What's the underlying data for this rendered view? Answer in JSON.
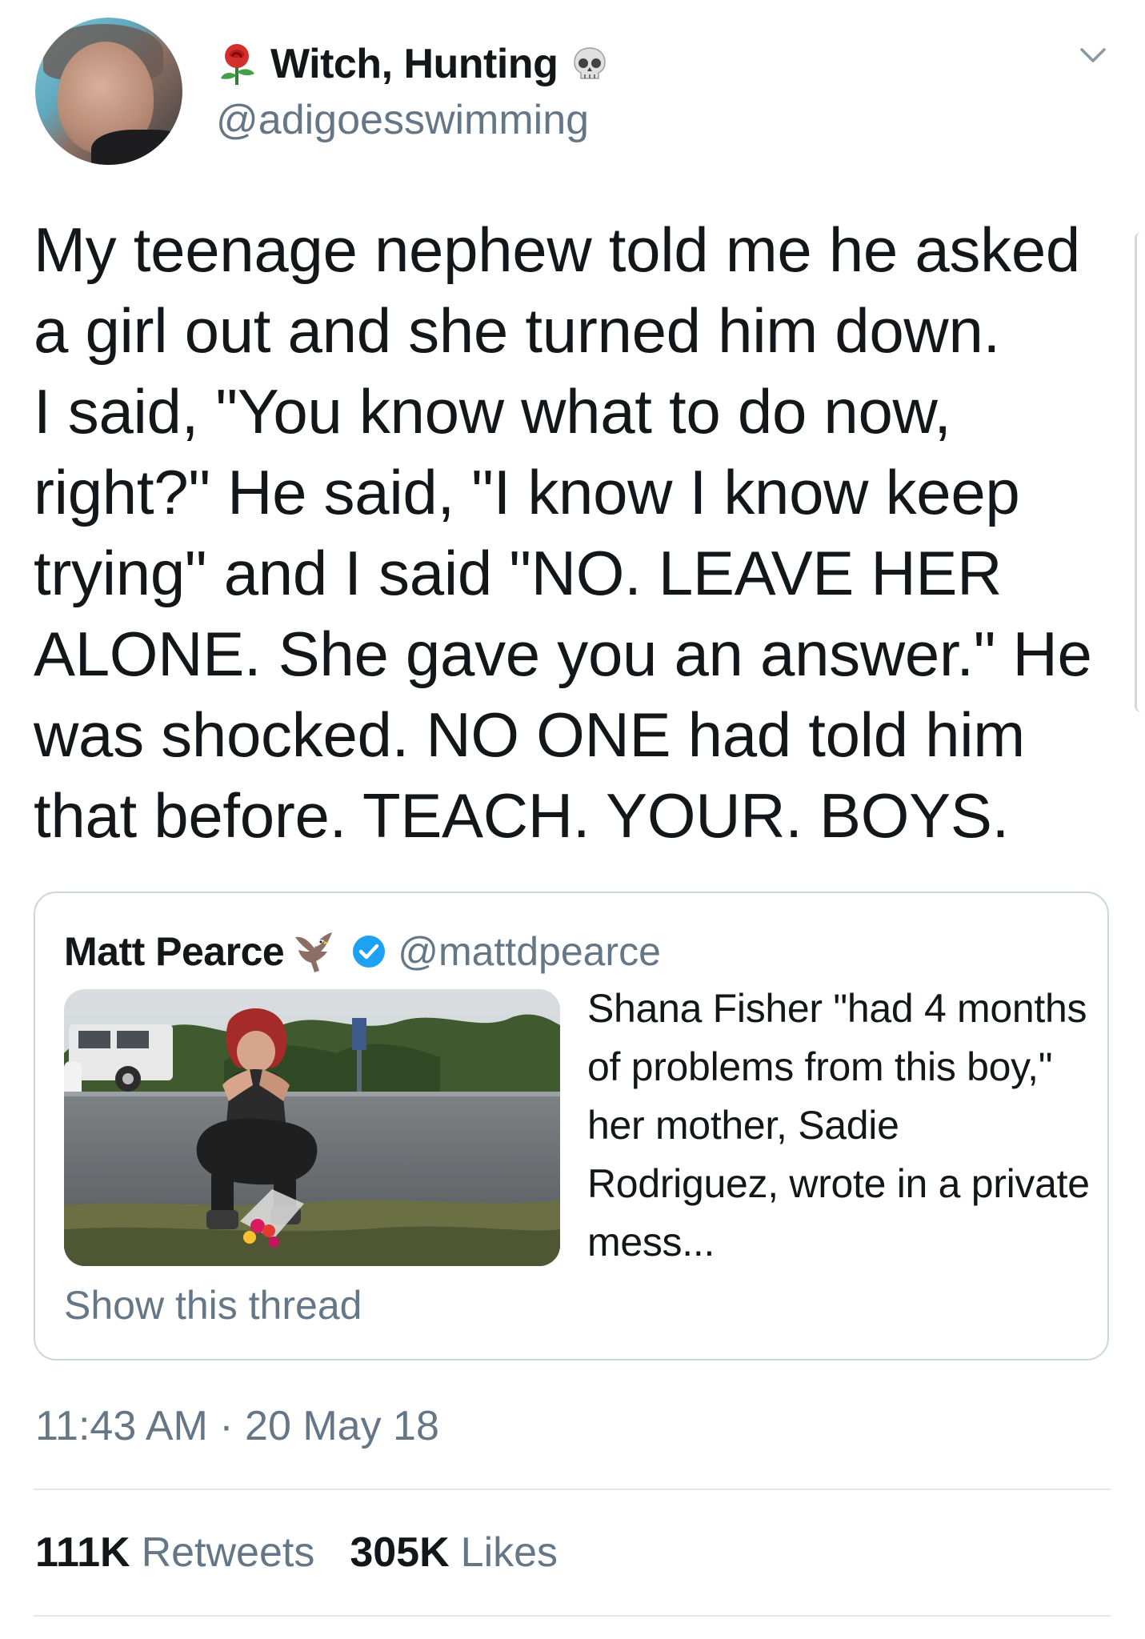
{
  "author": {
    "display_name": "Witch, Hunting",
    "handle": "@adigoesswimming",
    "name_prefix_icon": "rose-icon",
    "name_suffix_icon": "skull-icon"
  },
  "tweet": {
    "text": "My teenage nephew told me he asked\na girl out and she turned him down.\nI said, \"You know what to do now,\nright?\" He said, \"I know I know keep\ntrying\" and I said \"NO. LEAVE HER\nALONE. She gave you an answer.\" He\nwas shocked. NO ONE had told him\nthat before. TEACH. YOUR. BOYS."
  },
  "quote": {
    "display_name": "Matt Pearce",
    "name_icon": "eagle-icon",
    "verified_icon": "verified-icon",
    "handle": "@mattdpearce",
    "text": "Shana Fisher \"had 4 months of problems from this boy,\" her mother, Sadie Rodriguez, wrote in a private mess...",
    "show_thread": "Show this thread"
  },
  "meta": {
    "timestamp": "11:43 AM · 20 May 18"
  },
  "stats": {
    "retweets_count": "111K",
    "retweets_label": "Retweets",
    "likes_count": "305K",
    "likes_label": "Likes"
  },
  "colors": {
    "text_primary": "#14171a",
    "text_secondary": "#657786",
    "border": "#ccd6dd",
    "verified": "#1da1f2"
  }
}
